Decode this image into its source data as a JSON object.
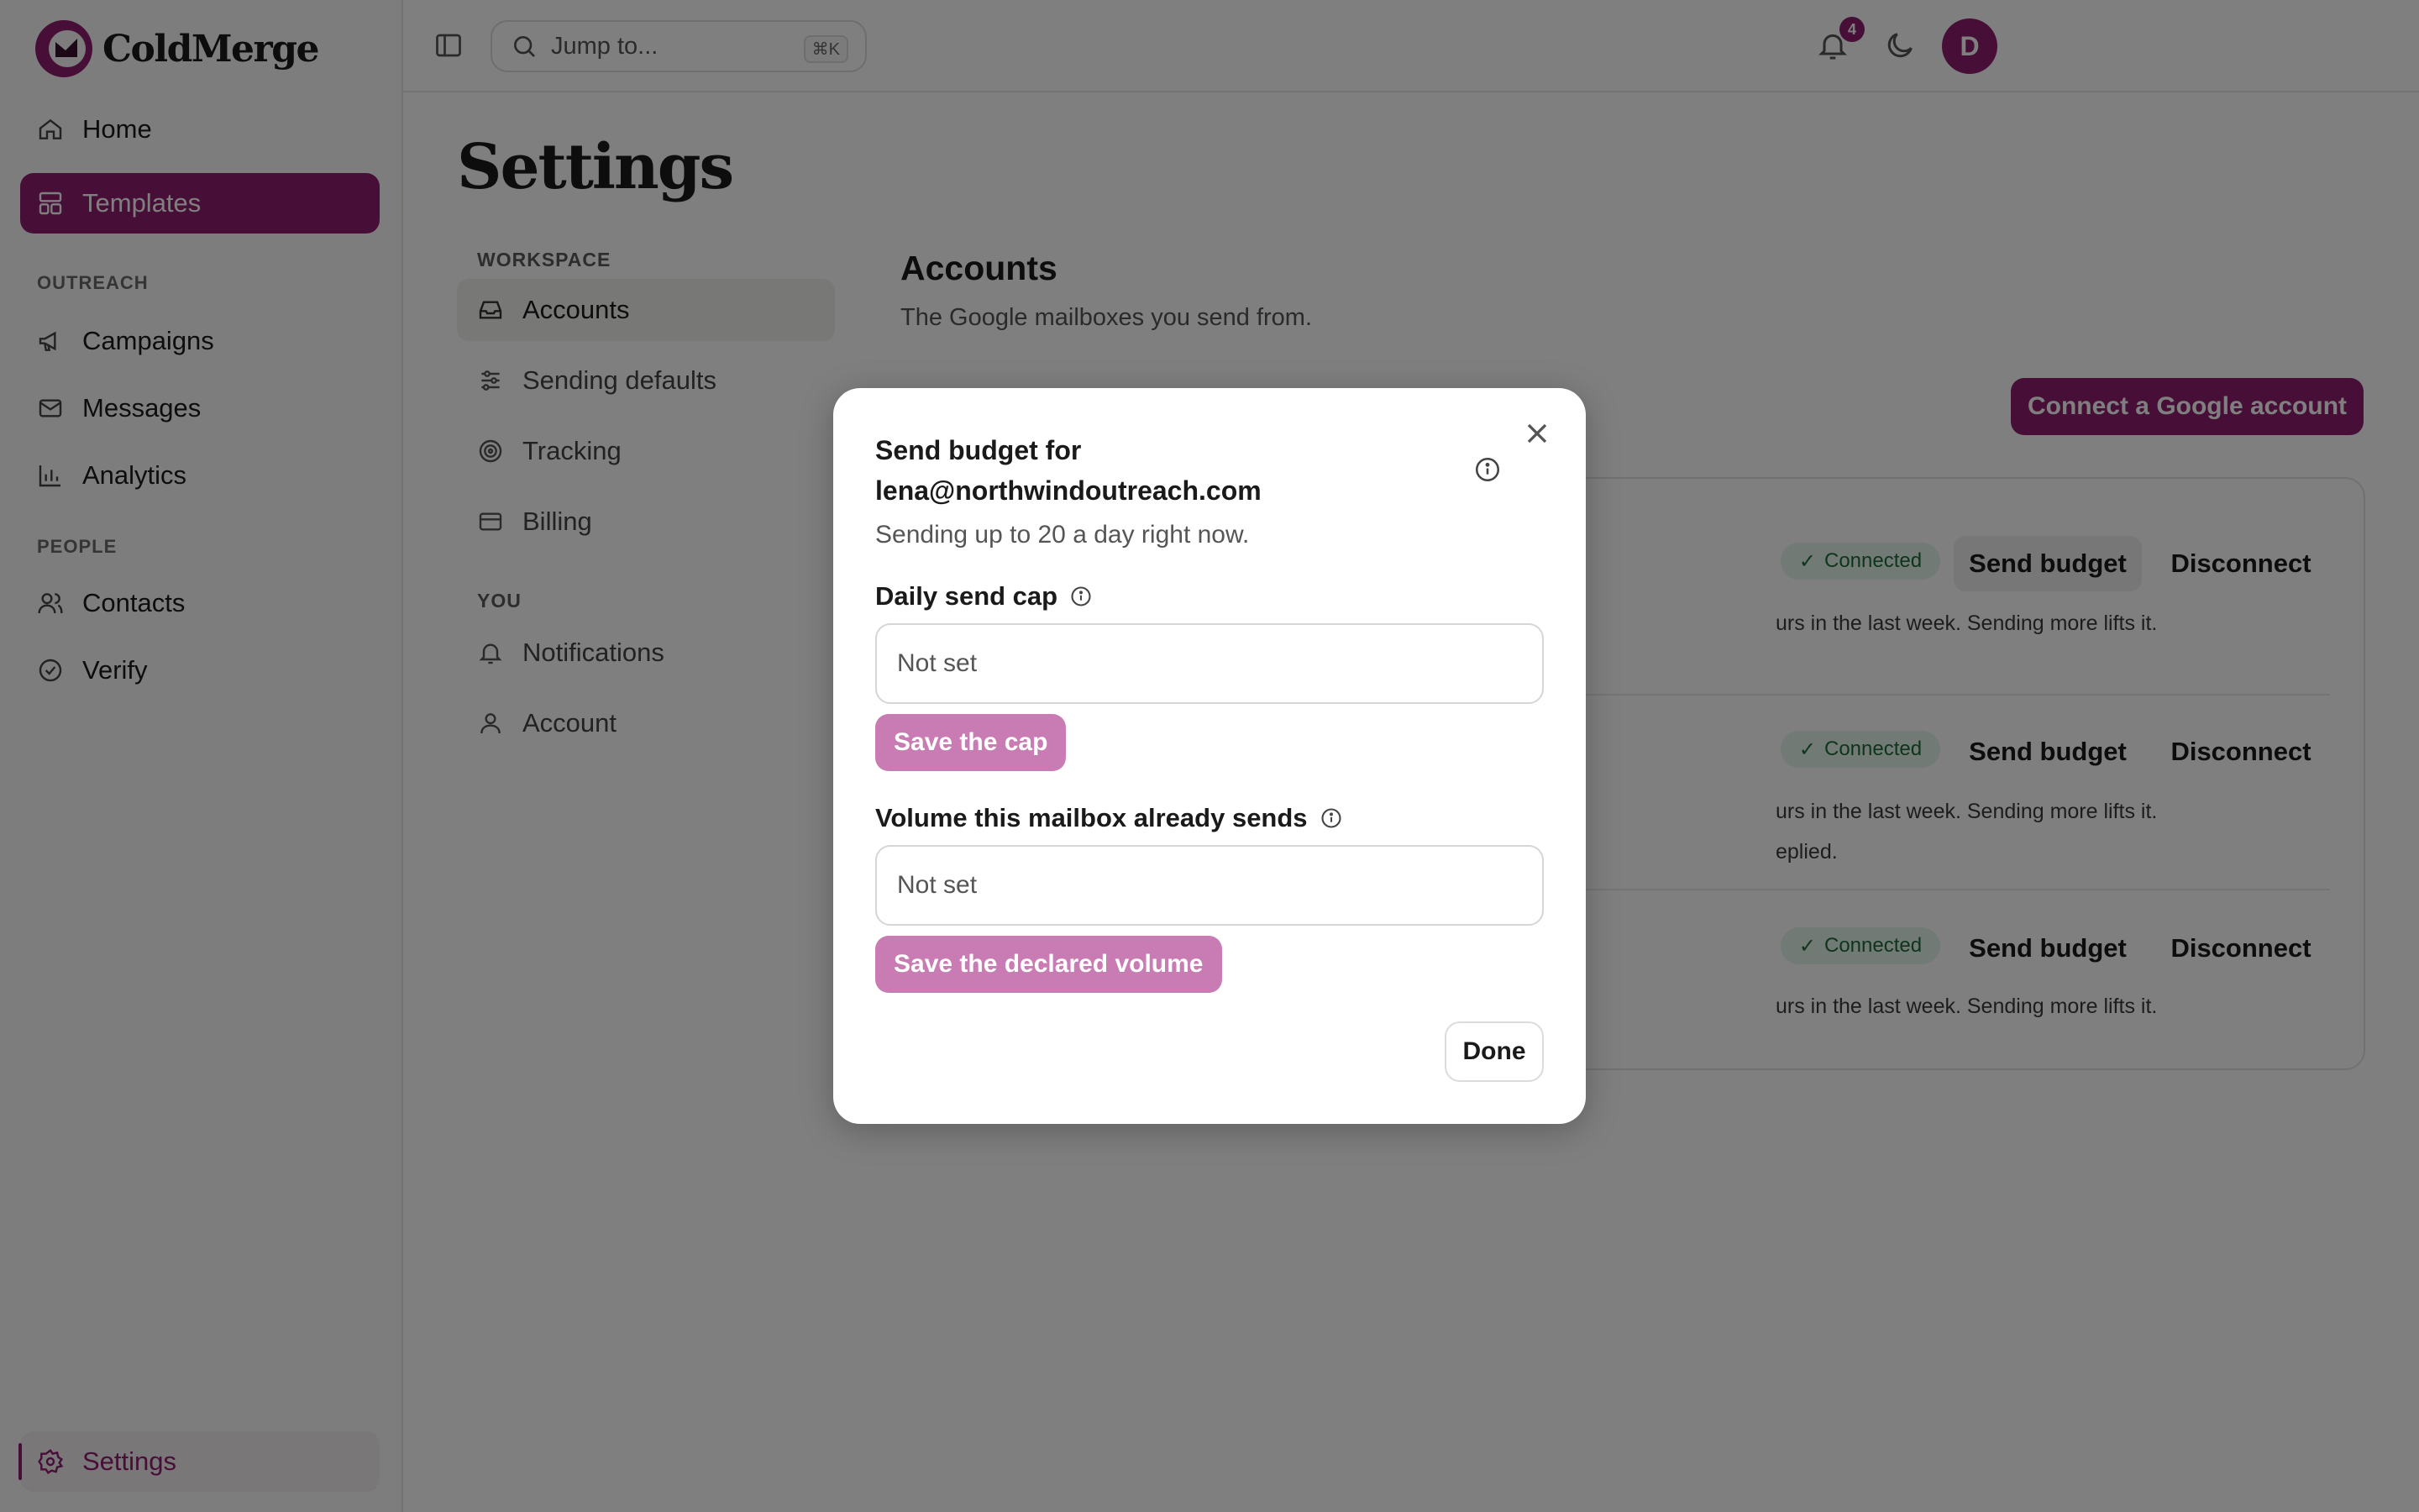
{
  "brand": {
    "name": "ColdMerge",
    "accent": "#8e1f6e"
  },
  "sidebar": {
    "items_top": [
      {
        "label": "Home",
        "icon": "home-icon"
      },
      {
        "label": "Templates",
        "icon": "templates-icon"
      }
    ],
    "sections": {
      "outreach": "OUTREACH",
      "people": "PEOPLE"
    },
    "outreach_items": [
      {
        "label": "Campaigns",
        "icon": "megaphone-icon"
      },
      {
        "label": "Messages",
        "icon": "mail-icon"
      },
      {
        "label": "Analytics",
        "icon": "bar-chart-icon"
      }
    ],
    "people_items": [
      {
        "label": "Contacts",
        "icon": "users-icon"
      },
      {
        "label": "Verify",
        "icon": "check-circle-icon"
      }
    ],
    "settings_label": "Settings"
  },
  "topbar": {
    "search_placeholder": "Jump to...",
    "shortcut": "⌘K",
    "notification_count": "4",
    "avatar_initial": "D"
  },
  "page": {
    "title": "Settings",
    "subnav": {
      "workspace_heading": "WORKSPACE",
      "workspace_items": [
        "Accounts",
        "Sending defaults",
        "Tracking",
        "Billing"
      ],
      "you_heading": "YOU",
      "you_items": [
        "Notifications",
        "Account"
      ]
    },
    "accounts": {
      "title": "Accounts",
      "subtitle": "The Google mailboxes you send from.",
      "connect_button": "Connect a Google account",
      "rows": [
        {
          "status": "Connected",
          "budget": "Send budget",
          "disconnect": "Disconnect",
          "note": "urs in the last week. Sending more lifts it.",
          "note2": ""
        },
        {
          "status": "Connected",
          "budget": "Send budget",
          "disconnect": "Disconnect",
          "note": "urs in the last week. Sending more lifts it.",
          "note2": "eplied."
        },
        {
          "status": "Connected",
          "budget": "Send budget",
          "disconnect": "Disconnect",
          "note": "urs in the last week. Sending more lifts it.",
          "note2": ""
        }
      ]
    }
  },
  "modal": {
    "title_line1": "Send budget for",
    "title_line2": "lena@northwindoutreach.com",
    "subtitle": "Sending up to 20 a day right now.",
    "cap_label": "Daily send cap",
    "cap_placeholder": "Not set",
    "cap_save": "Save the cap",
    "volume_label": "Volume this mailbox already sends",
    "volume_placeholder": "Not set",
    "volume_save": "Save the declared volume",
    "done": "Done"
  }
}
